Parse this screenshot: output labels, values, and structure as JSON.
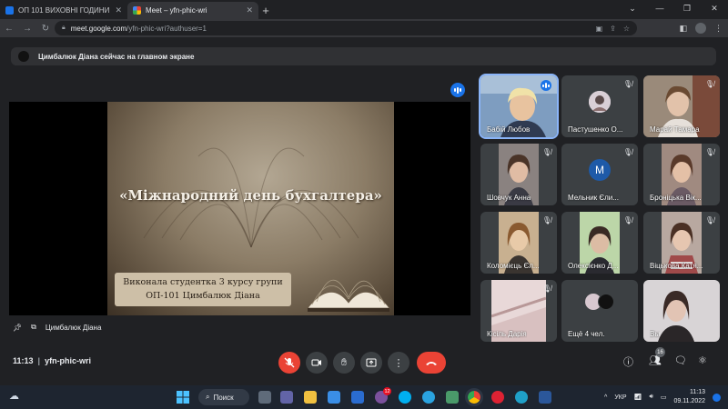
{
  "browser": {
    "tabs": [
      {
        "title": "ОП 101 ВИХОВНІ ГОДИНИ",
        "favicon_color": "#1a73e8"
      },
      {
        "title": "Meet – yfn-phic-wri",
        "favicon_color": "#34a853"
      }
    ],
    "address": {
      "host": "meet.google.com",
      "path": "/yfn-phic-wri?authuser=1"
    }
  },
  "banner": {
    "text": "Цимбалюк Діана сейчас на главном экране"
  },
  "presentation": {
    "slide_title": "«Міжнародний день бухгалтера»",
    "slide_line1": "Виконала студентка 3 курсу групи",
    "slide_line2": "ОП-101 Цимбалюк Діана",
    "presenter_name": "Цимбалюк Діана"
  },
  "participants": [
    {
      "name": "Бабій Любов",
      "speaking": true
    },
    {
      "name": "Пастушенко О...",
      "muted": true
    },
    {
      "name": "Марай Тамара",
      "muted": true
    },
    {
      "name": "Шовчук Анна",
      "muted": true
    },
    {
      "name": "Мельник Єли...",
      "muted": true,
      "initial": "M"
    },
    {
      "name": "Броніцька Вік...",
      "muted": true
    },
    {
      "name": "Коломієць Єл...",
      "muted": true
    },
    {
      "name": "Олексієнко Д...",
      "muted": true
    },
    {
      "name": "Віцькова Катя...",
      "muted": true
    },
    {
      "name": "Кісіль Дарія",
      "muted": true
    },
    {
      "name": "Ещё 4 чел."
    },
    {
      "name": "Вы"
    }
  ],
  "meeting": {
    "time": "11:13",
    "code": "yfn-phic-wri",
    "people_count": "16"
  },
  "taskbar": {
    "search_label": "Поиск",
    "notification_count": "12",
    "language": "УКР",
    "time": "11:13",
    "date": "09.11.2022"
  }
}
